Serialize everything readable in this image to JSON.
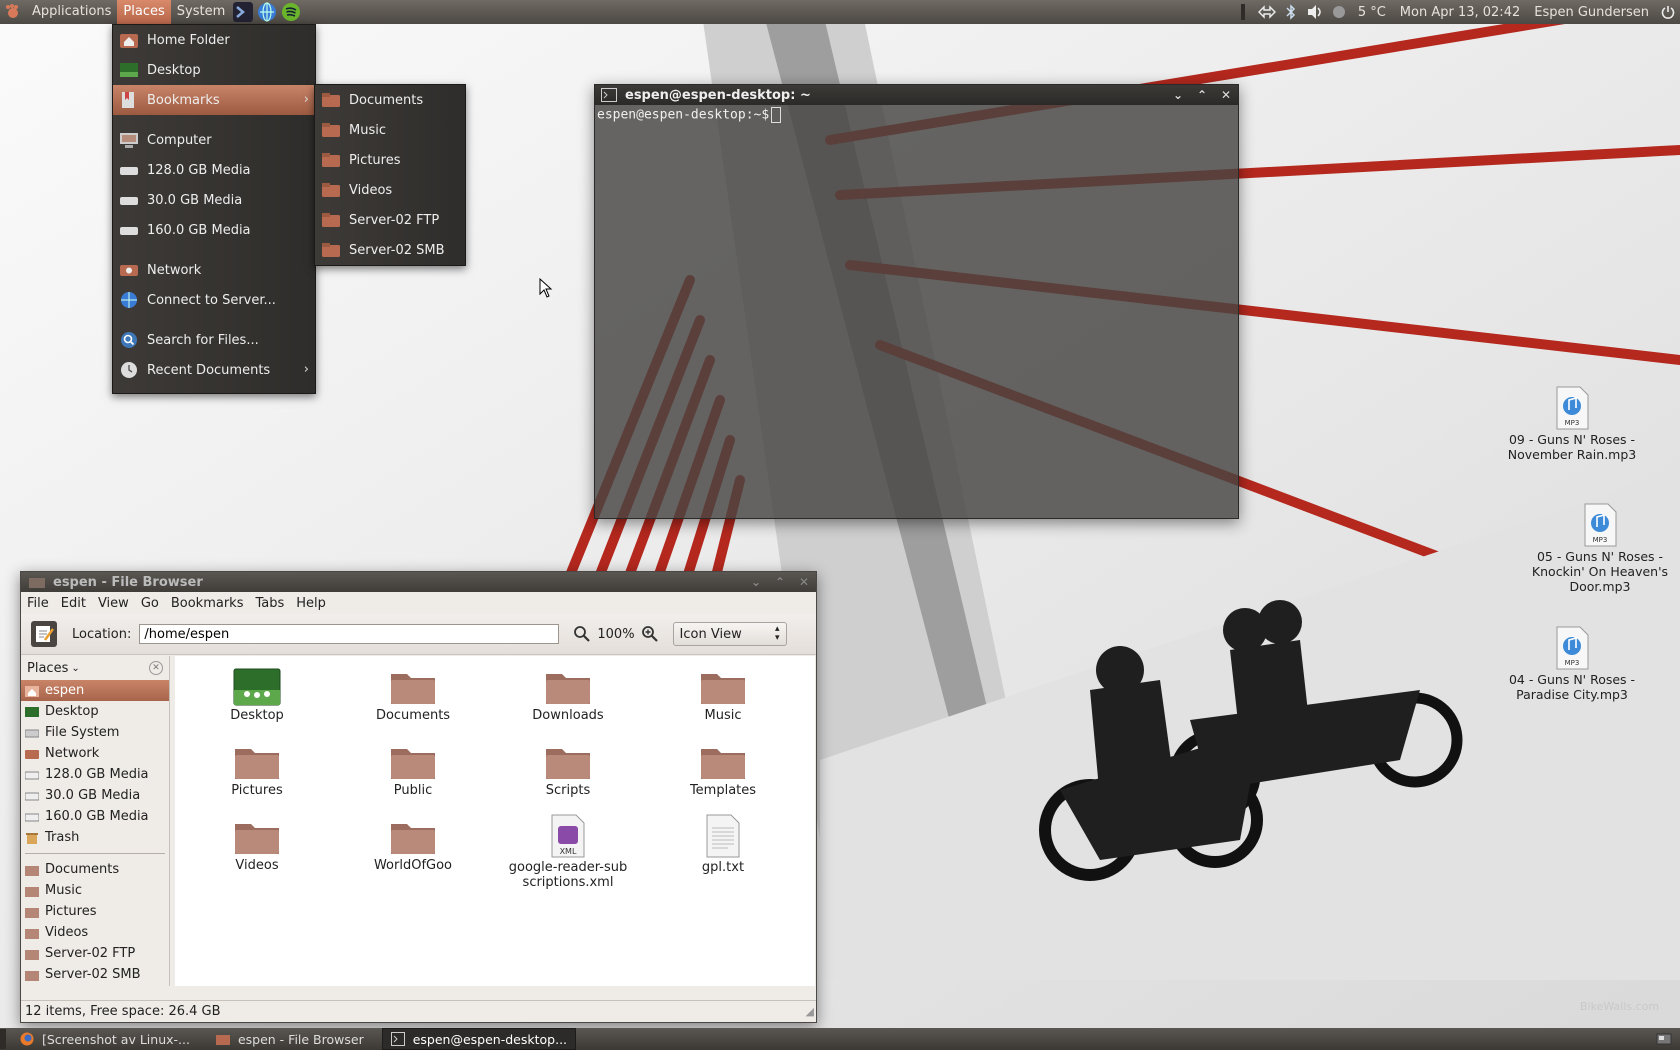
{
  "top_panel": {
    "menus": [
      "Applications",
      "Places",
      "System"
    ],
    "clock": "Mon Apr 13, 02:42",
    "weather": "5 °C",
    "user": "Espen Gundersen"
  },
  "places_menu": {
    "items": [
      "Home Folder",
      "Desktop",
      "Bookmarks",
      "Computer",
      "128.0 GB Media",
      "30.0 GB Media",
      "160.0 GB Media",
      "Network",
      "Connect to Server...",
      "Search for Files...",
      "Recent Documents"
    ]
  },
  "bookmarks_submenu": {
    "items": [
      "Documents",
      "Music",
      "Pictures",
      "Videos",
      "Server-02 FTP",
      "Server-02 SMB"
    ]
  },
  "terminal": {
    "title": "espen@espen-desktop: ~",
    "prompt": "espen@espen-desktop:~$"
  },
  "file_browser": {
    "title": "espen - File Browser",
    "menubar": [
      "File",
      "Edit",
      "View",
      "Go",
      "Bookmarks",
      "Tabs",
      "Help"
    ],
    "location_label": "Location:",
    "location_value": "/home/espen",
    "zoom": "100%",
    "view_mode": "Icon View",
    "sidebar_title": "Places",
    "sidebar_places": [
      "espen",
      "Desktop",
      "File System",
      "Network",
      "128.0 GB Media",
      "30.0 GB Media",
      "160.0 GB Media",
      "Trash"
    ],
    "sidebar_bookmarks": [
      "Documents",
      "Music",
      "Pictures",
      "Videos",
      "Server-02 FTP",
      "Server-02 SMB"
    ],
    "files": [
      "Desktop",
      "Documents",
      "Downloads",
      "Music",
      "Pictures",
      "Public",
      "Scripts",
      "Templates",
      "Videos",
      "WorldOfGoo",
      "google-reader-subscriptions.xml",
      "gpl.txt"
    ],
    "file_badge_xml": "XML",
    "status": "12 items, Free space: 26.4 GB"
  },
  "desktop_icons": [
    {
      "label": "09 - Guns N' Roses - November Rain.mp3"
    },
    {
      "label": "05 - Guns N' Roses - Knockin' On Heaven's Door.mp3"
    },
    {
      "label": "04 - Guns N' Roses - Paradise City.mp3"
    }
  ],
  "desktop_icon_badge": "MP3",
  "taskbar": {
    "tasks": [
      "[Screenshot av Linux-...",
      "espen - File Browser",
      "espen@espen-desktop..."
    ]
  },
  "watermark": "BikeWalls.com",
  "colors": {
    "accent": "#c98468",
    "folder": "#b98a7a",
    "panel": "#4c4843"
  }
}
